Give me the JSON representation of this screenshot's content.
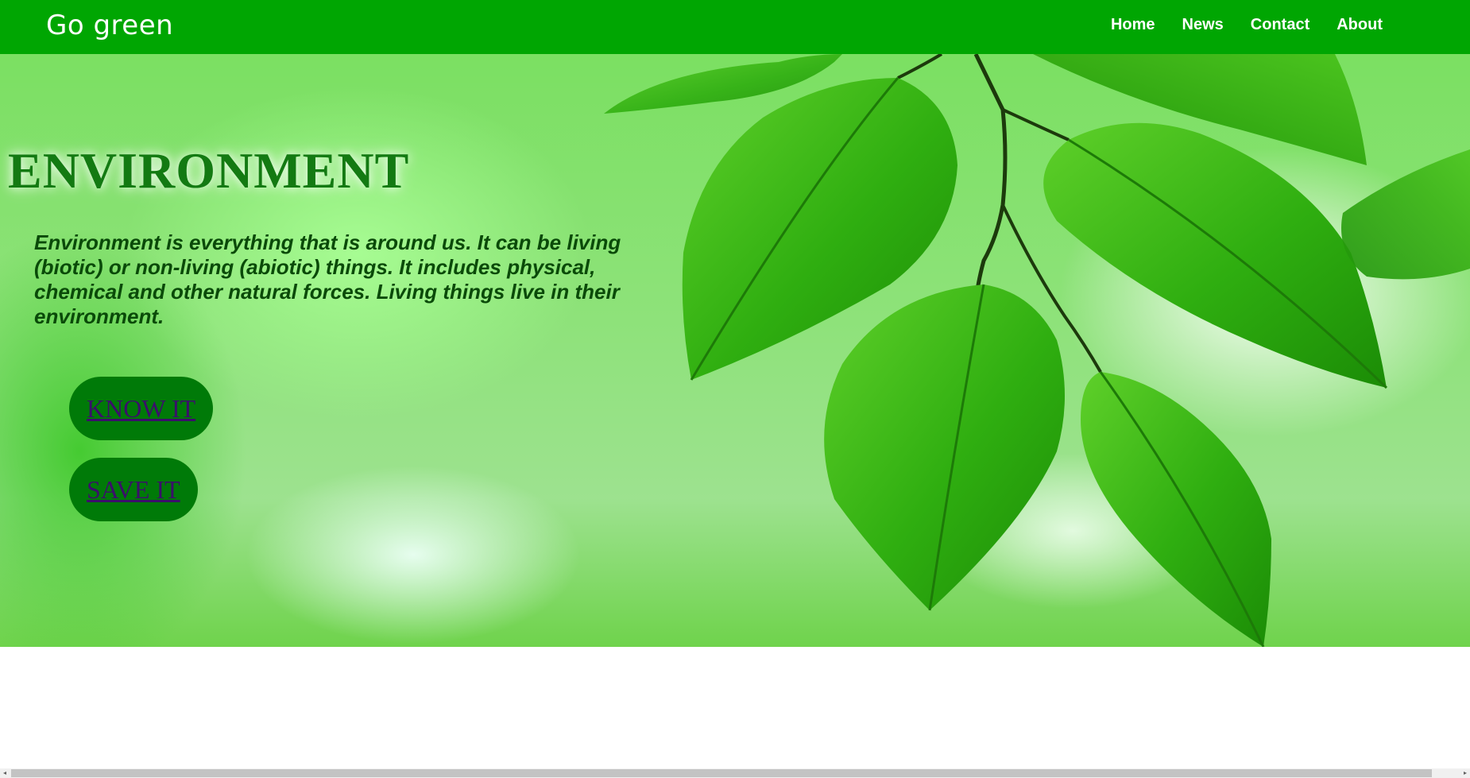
{
  "header": {
    "brand": "Go green",
    "nav": [
      "Home",
      "News",
      "Contact",
      "About"
    ],
    "background_color": "#00a602"
  },
  "hero": {
    "title": "ENVIRONMENT",
    "description": "Environment is everything that is around us. It can be living (biotic) or non-living (abiotic) things. It includes physical, chemical and other natural forces. Living things live in their environment.",
    "buttons": {
      "know": "KNOW IT",
      "save": "SAVE IT"
    },
    "background": "green-leaves-image"
  },
  "scrollbar": {
    "left_arrow": "◂",
    "right_arrow": "▸"
  }
}
